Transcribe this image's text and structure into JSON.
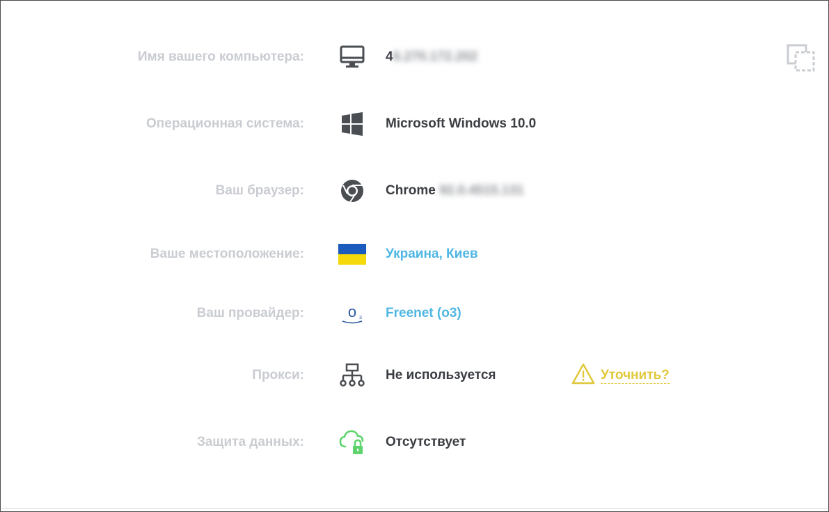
{
  "rows": [
    {
      "label": "Имя вашего компьютера:",
      "value": "4",
      "value_hidden": "6.270.172.202"
    },
    {
      "label": "Операционная система:",
      "value": "Microsoft Windows 10.0"
    },
    {
      "label": "Ваш браузер:",
      "value": "Chrome",
      "value_hidden": "92.0.4515.131"
    },
    {
      "label": "Ваше местоположение:",
      "value": "Украина, Киев"
    },
    {
      "label": "Ваш провайдер:",
      "value": "Freenet (o3)",
      "provider_logo": "o"
    },
    {
      "label": "Прокси:",
      "value": "Не используется",
      "clarify": "Уточнить?"
    },
    {
      "label": "Защита данных:",
      "value": "Отсутствует"
    }
  ],
  "icons": {
    "computer": "monitor-icon",
    "os": "windows-icon",
    "browser": "chrome-icon",
    "location": "ukraine-flag-icon",
    "provider": "provider-logo-icon",
    "proxy": "network-icon",
    "protection": "cloud-lock-icon",
    "clarify": "warning-icon",
    "copy": "copy-icon"
  },
  "colors": {
    "label": "#c9ccd1",
    "value": "#3a3d42",
    "link": "#4fb7e3",
    "warning": "#e0c83a",
    "success": "#5cd36b",
    "flag_blue": "#1a5bbd",
    "flag_yellow": "#f5d90a"
  }
}
